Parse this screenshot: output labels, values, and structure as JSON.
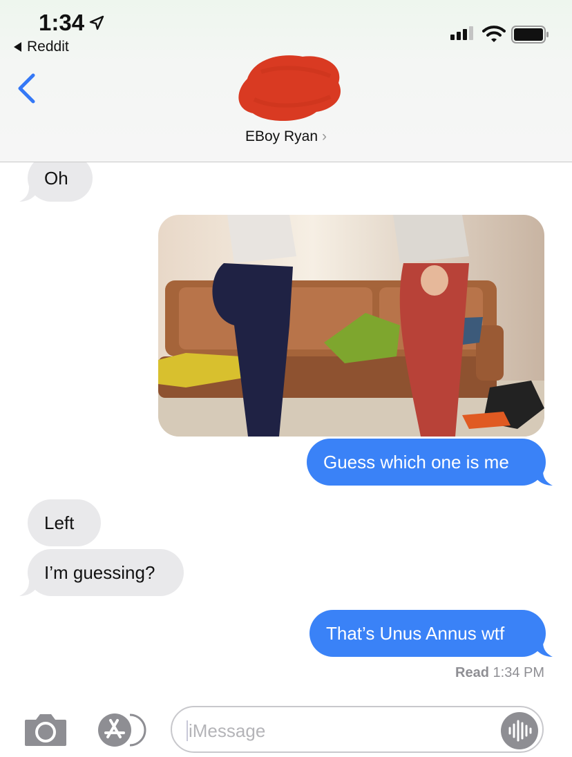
{
  "status_bar": {
    "time": "1:34",
    "back_app": "Reddit"
  },
  "nav": {
    "contact_name": "EBoy Ryan",
    "chevron": "›"
  },
  "messages": [
    {
      "side": "received",
      "text": "Oh"
    },
    {
      "side": "sent",
      "type": "image",
      "description_icon": "photo-two-people-by-couch"
    },
    {
      "side": "sent",
      "text": "Guess which one is me"
    },
    {
      "side": "received",
      "text": "Left"
    },
    {
      "side": "received",
      "text": "I’m guessing?"
    },
    {
      "side": "sent",
      "text": "That’s Unus Annus wtf"
    }
  ],
  "receipt": {
    "label": "Read",
    "time": "1:34 PM"
  },
  "composer": {
    "placeholder": "iMessage"
  },
  "colors": {
    "sent_bubble": "#3a82f7",
    "received_bubble": "#e9e9eb",
    "accent": "#3478f6",
    "redaction": "#d93a22"
  }
}
